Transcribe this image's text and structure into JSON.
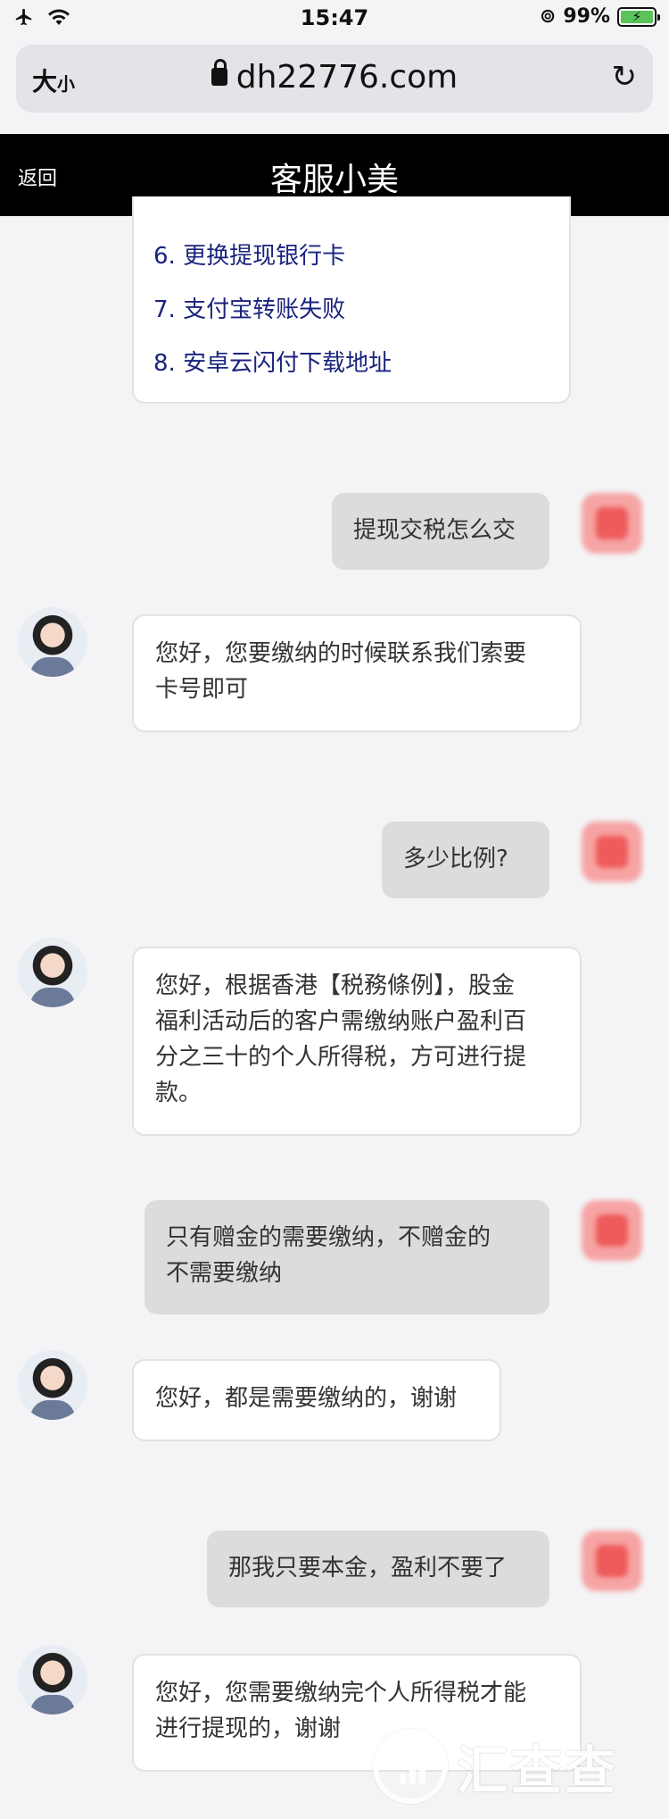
{
  "status_bar": {
    "time": "15:47",
    "battery": "99%"
  },
  "url_bar": {
    "text_size_label_big": "大",
    "text_size_label_small": "小",
    "url": "dh22776.com"
  },
  "header": {
    "back": "返回",
    "title": "客服小美"
  },
  "menu_items": [
    "6.  更换提现银行卡",
    "7.  支付宝转账失败",
    "8.  安卓云闪付下载地址"
  ],
  "messages": {
    "u1": "提现交税怎么交",
    "a1": [
      "您好，您要缴纳的时候联系我们索要",
      "卡号即可"
    ],
    "u2": "多少比例?",
    "a2": [
      "您好，根据香港【税務條例】，股金",
      "福利活动后的客户需缴纳账户盈利百",
      "分之三十的个人所得税，方可进行提",
      "款。"
    ],
    "u3": [
      "只有赠金的需要缴纳，不赠金的",
      "不需要缴纳"
    ],
    "a3": "您好，都是需要缴纳的，谢谢",
    "u4": "那我只要本金，盈利不要了",
    "a4": [
      "您好，您需要缴纳完个人所得税才能",
      "进行提现的，谢谢"
    ]
  },
  "watermark": "汇查查"
}
